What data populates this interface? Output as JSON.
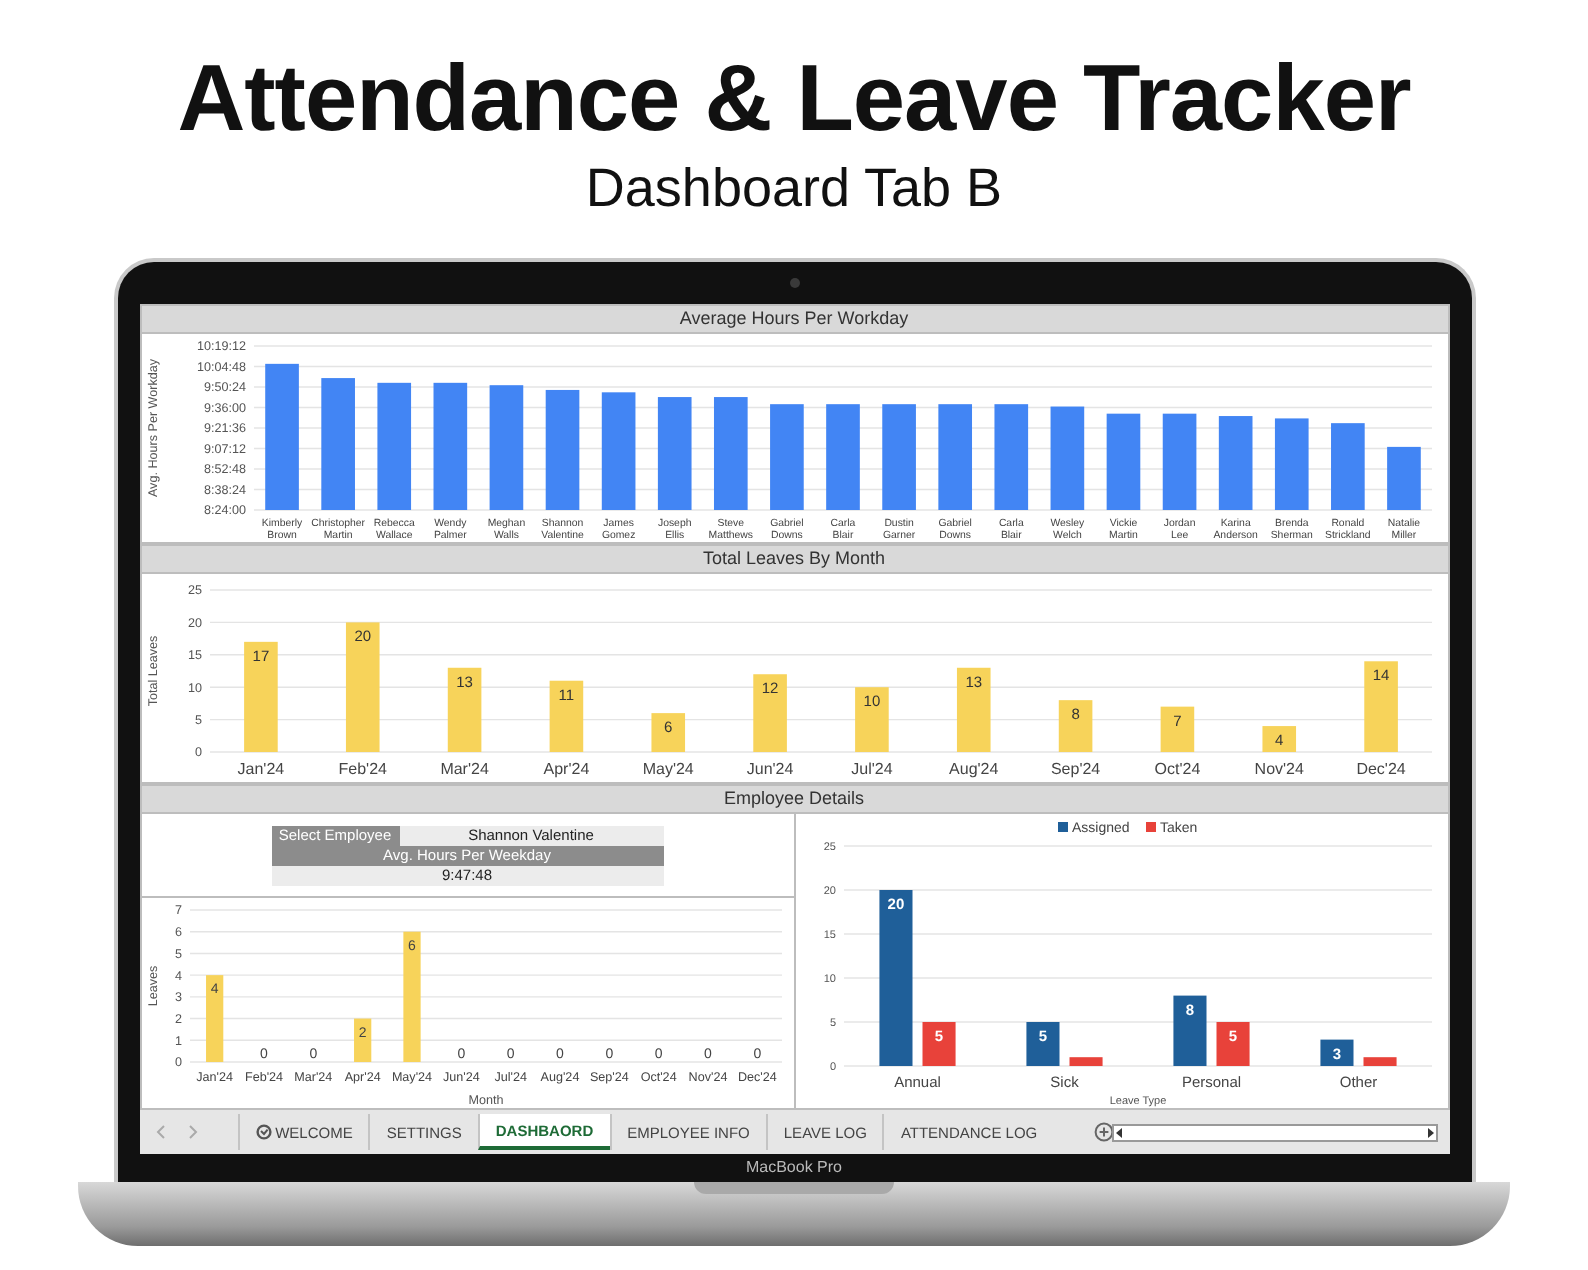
{
  "title": "Attendance & Leave Tracker",
  "subtitle": "Dashboard Tab B",
  "device_label": "MacBook Pro",
  "average_hours": {
    "title": "Average Hours Per Workday",
    "chart_data": {
      "type": "bar",
      "ylabel": "Avg. Hours Per Workday",
      "categories": [
        "Kimberly Brown",
        "Christopher Martin",
        "Rebecca Wallace",
        "Wendy Palmer",
        "Meghan Walls",
        "Shannon Valentine",
        "James Gomez",
        "Joseph Ellis",
        "Steve Matthews",
        "Gabriel Downs",
        "Carla Blair",
        "Dustin Garner",
        "Gabriel Downs",
        "Carla Blair",
        "Wesley Welch",
        "Vickie Martin",
        "Jordan Lee",
        "Karina Anderson",
        "Brenda Sherman",
        "Ronald Strickland",
        "Natalie Miller"
      ],
      "series": [
        {
          "color": "#4285f4",
          "values": [
            36400,
            35800,
            35600,
            35600,
            35500,
            35300,
            35200,
            35000,
            35000,
            34700,
            34700,
            34700,
            34700,
            34700,
            34600,
            34300,
            34300,
            34200,
            34100,
            33900,
            32900
          ]
        }
      ],
      "grid": true,
      "ylim": [
        30240,
        37152
      ],
      "yticks": [
        {
          "value": 30240,
          "label": "8:24:00"
        },
        {
          "value": 31104,
          "label": "8:38:24"
        },
        {
          "value": 31968,
          "label": "8:52:48"
        },
        {
          "value": 32832,
          "label": "9:07:12"
        },
        {
          "value": 33696,
          "label": "9:21:36"
        },
        {
          "value": 34560,
          "label": "9:36:00"
        },
        {
          "value": 35424,
          "label": "9:50:24"
        },
        {
          "value": 36288,
          "label": "10:04:48"
        },
        {
          "value": 37152,
          "label": "10:19:12"
        }
      ]
    }
  },
  "total_leaves": {
    "title": "Total Leaves By Month",
    "chart_data": {
      "type": "bar",
      "ylabel": "Total Leaves",
      "categories": [
        "Jan'24",
        "Feb'24",
        "Mar'24",
        "Apr'24",
        "May'24",
        "Jun'24",
        "Jul'24",
        "Aug'24",
        "Sep'24",
        "Oct'24",
        "Nov'24",
        "Dec'24"
      ],
      "series": [
        {
          "color": "#f7d35a",
          "values": [
            17,
            20,
            13,
            11,
            6,
            12,
            10,
            13,
            8,
            7,
            4,
            14
          ]
        }
      ],
      "grid": true,
      "ylim": [
        0,
        25
      ],
      "yticks": [
        0,
        5,
        10,
        15,
        20,
        25
      ],
      "data_labels": true
    }
  },
  "employee_details": {
    "title": "Employee Details",
    "select_label": "Select Employee",
    "employee": "Shannon Valentine",
    "avg_label": "Avg. Hours Per Weekday",
    "avg_value": "9:47:48",
    "monthly_chart": {
      "chart_data": {
        "type": "bar",
        "xlabel": "Month",
        "ylabel": "Leaves",
        "categories": [
          "Jan'24",
          "Feb'24",
          "Mar'24",
          "Apr'24",
          "May'24",
          "Jun'24",
          "Jul'24",
          "Aug'24",
          "Sep'24",
          "Oct'24",
          "Nov'24",
          "Dec'24"
        ],
        "series": [
          {
            "color": "#f7d35a",
            "values": [
              4,
              0,
              0,
              2,
              6,
              0,
              0,
              0,
              0,
              0,
              0,
              0
            ]
          }
        ],
        "grid": true,
        "ylim": [
          0,
          7
        ],
        "yticks": [
          0,
          1,
          2,
          3,
          4,
          5,
          6,
          7
        ],
        "data_labels": true
      }
    },
    "leave_type_chart": {
      "chart_data": {
        "type": "bar",
        "xlabel": "Leave Type",
        "categories": [
          "Annual",
          "Sick",
          "Personal",
          "Other"
        ],
        "series": [
          {
            "name": "Assigned",
            "color": "#1f5f99",
            "values": [
              20,
              5,
              8,
              3
            ]
          },
          {
            "name": "Taken",
            "color": "#e8423a",
            "values": [
              5,
              1,
              5,
              1
            ]
          }
        ],
        "ylim": [
          0,
          25
        ],
        "yticks": [
          0,
          5,
          10,
          15,
          20,
          25
        ],
        "grid": true,
        "legend": true,
        "value_labels": [
          [
            "20",
            "5",
            "8",
            "3"
          ],
          [
            "5",
            null,
            "5",
            null
          ]
        ]
      }
    }
  },
  "sheet_tabs": [
    {
      "label": "WELCOME",
      "kind": "icon",
      "selected": false
    },
    {
      "label": "SETTINGS",
      "kind": "plain",
      "selected": false
    },
    {
      "label": "DASHBAORD",
      "kind": "plain",
      "selected": true
    },
    {
      "label": "EMPLOYEE INFO",
      "kind": "plain",
      "selected": false
    },
    {
      "label": "LEAVE LOG",
      "kind": "plain",
      "selected": false
    },
    {
      "label": "ATTENDANCE LOG",
      "kind": "plain",
      "selected": false
    }
  ]
}
